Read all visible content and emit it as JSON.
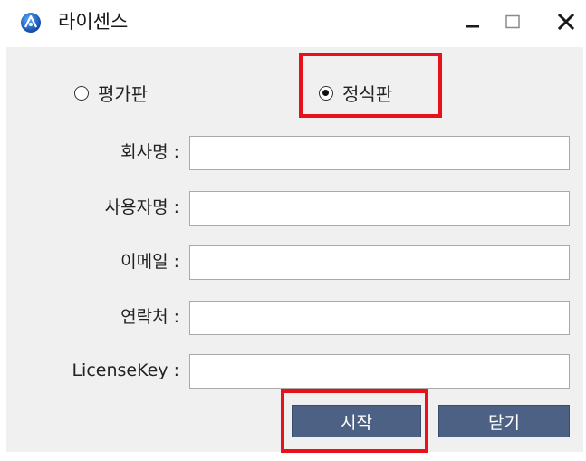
{
  "window": {
    "title": "라이센스",
    "icon": "app-logo-icon",
    "controls": {
      "minimize_icon": "minimize-icon",
      "maximize_icon": "maximize-icon",
      "close_icon": "close-icon"
    }
  },
  "license_type": {
    "options": [
      {
        "label": "평가판",
        "checked": false
      },
      {
        "label": "정식판",
        "checked": true
      }
    ]
  },
  "form": {
    "fields": [
      {
        "label": "회사명 :",
        "value": ""
      },
      {
        "label": "사용자명 :",
        "value": ""
      },
      {
        "label": "이메일 :",
        "value": ""
      },
      {
        "label": "연락처 :",
        "value": ""
      },
      {
        "label": "LicenseKey :",
        "value": ""
      }
    ]
  },
  "buttons": {
    "start_label": "시작",
    "close_label": "닫기"
  },
  "colors": {
    "highlight": "#e8111b",
    "button_bg": "#4d6184",
    "client_bg": "#f0f0f0"
  }
}
